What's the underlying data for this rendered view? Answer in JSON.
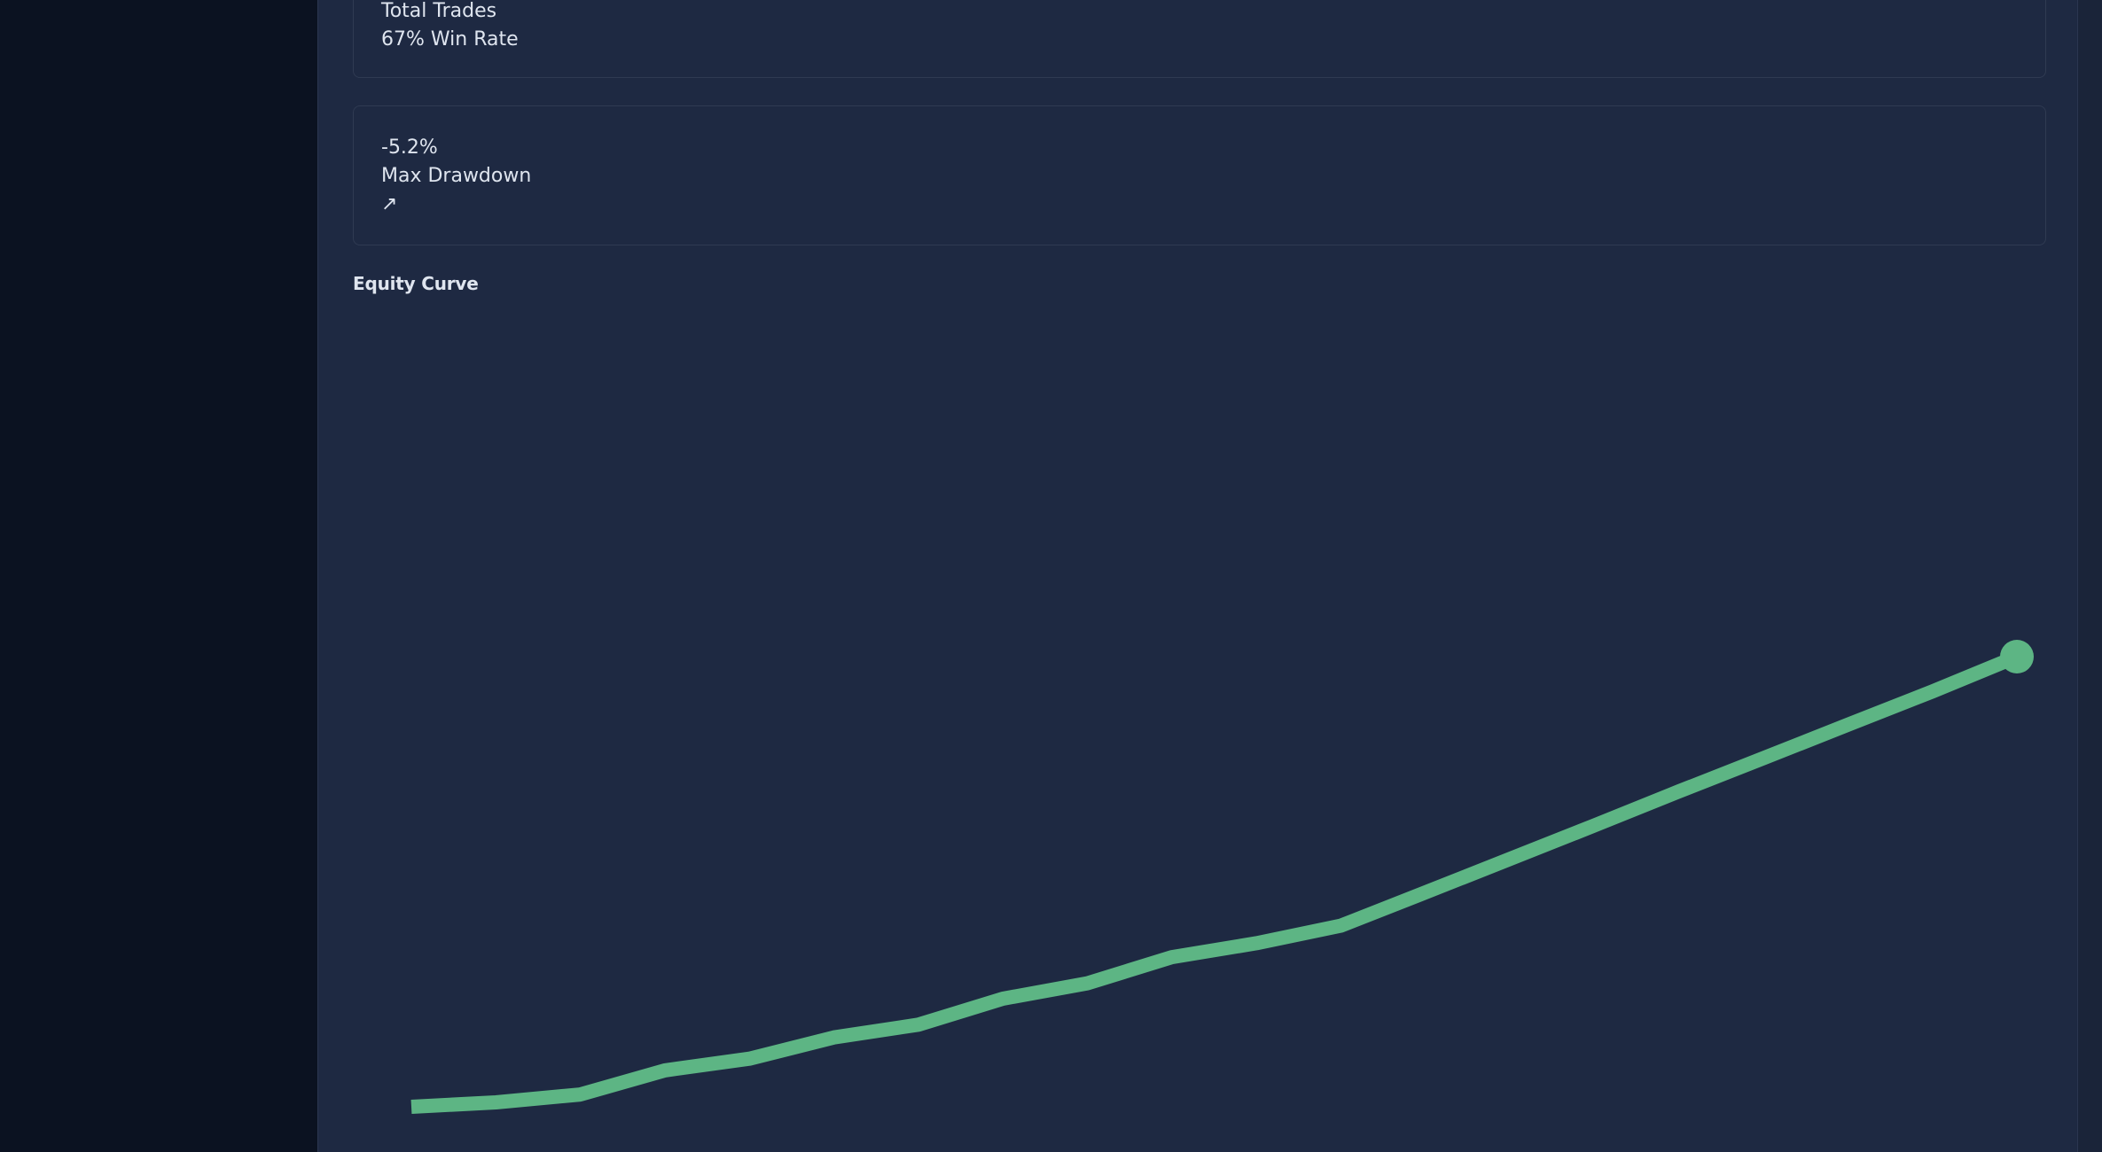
{
  "stats": {
    "trades": {
      "label": "Total Trades",
      "sub": "67% Win Rate"
    },
    "drawdown": {
      "value": "-5.2%",
      "label": "Max Drawdown",
      "trend_icon": "↗"
    }
  },
  "chart": {
    "title": "Equity Curve"
  },
  "colors": {
    "line": "#5db584",
    "panel": "#1e2942",
    "sidebar": "#0b1221"
  },
  "chart_data": {
    "type": "line",
    "title": "Equity Curve",
    "xlabel": "",
    "ylabel": "",
    "grid": false,
    "legend": "none",
    "x": [
      0,
      1,
      2,
      3,
      4,
      5,
      6,
      7,
      8,
      9,
      10,
      11,
      12,
      13,
      14,
      15,
      16,
      17,
      18,
      19
    ],
    "series": [
      {
        "values": [
          0,
          1.7,
          4.7,
          13.9,
          18.4,
          26.5,
          31.4,
          41.3,
          47.2,
          57.2,
          62.5,
          69.2,
          81.9,
          94.7,
          107.5,
          120.5,
          133.2,
          146.0,
          158.7,
          172.0
        ]
      }
    ],
    "ylim": [
      0,
      172
    ],
    "end_marker": true
  }
}
